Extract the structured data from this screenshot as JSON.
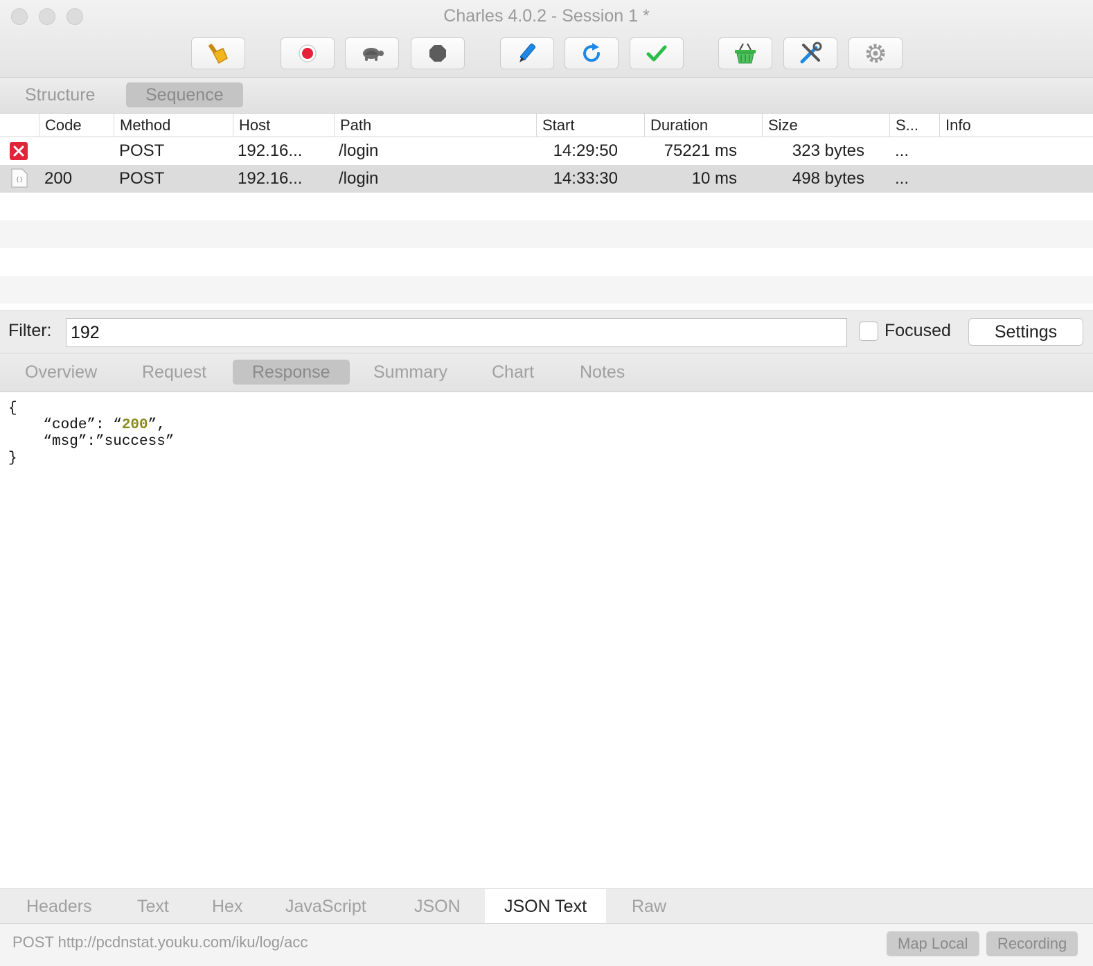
{
  "window": {
    "title": "Charles 4.0.2 - Session 1 *"
  },
  "toolbar": {
    "buttons": [
      {
        "name": "broom-icon"
      },
      {
        "name": "record-icon"
      },
      {
        "name": "turtle-icon"
      },
      {
        "name": "stop-icon"
      },
      {
        "name": "pen-icon"
      },
      {
        "name": "refresh-icon"
      },
      {
        "name": "check-icon"
      },
      {
        "name": "basket-icon"
      },
      {
        "name": "tools-icon"
      },
      {
        "name": "gear-icon"
      }
    ],
    "colors": {
      "record": "#e8213b",
      "refresh": "#1e88e5",
      "check": "#2bbd4a",
      "basket": "#3bb54a",
      "broom": "#f2b51c"
    }
  },
  "view_tabs": {
    "structure": "Structure",
    "sequence": "Sequence"
  },
  "table": {
    "headers": [
      "Code",
      "Method",
      "Host",
      "Path",
      "Start",
      "Duration",
      "Size",
      "S...",
      "Info"
    ],
    "rows": [
      {
        "status": "error",
        "code": "",
        "method": "POST",
        "host": "192.16...",
        "path": "/login",
        "start": "14:29:50",
        "duration": "75221 ms",
        "size": "323 bytes",
        "s": "...",
        "info": ""
      },
      {
        "status": "json",
        "code": "200",
        "method": "POST",
        "host": "192.16...",
        "path": "/login",
        "start": "14:33:30",
        "duration": "10 ms",
        "size": "498 bytes",
        "s": "...",
        "info": ""
      }
    ]
  },
  "filter": {
    "label": "Filter:",
    "value": "192",
    "focused_label": "Focused",
    "settings_label": "Settings"
  },
  "detail_tabs": [
    "Overview",
    "Request",
    "Response",
    "Summary",
    "Chart",
    "Notes"
  ],
  "response_body": {
    "open": "{",
    "line1_key": "    “code”: “",
    "line1_val": "200",
    "line1_end": "”,",
    "line2": "    “msg”:”success”",
    "close": "}"
  },
  "bottom_tabs": [
    "Headers",
    "Text",
    "Hex",
    "JavaScript",
    "JSON",
    "JSON Text",
    "Raw"
  ],
  "status": {
    "text": "POST http://pcdnstat.youku.com/iku/log/acc",
    "map_local": "Map Local",
    "recording": "Recording"
  }
}
